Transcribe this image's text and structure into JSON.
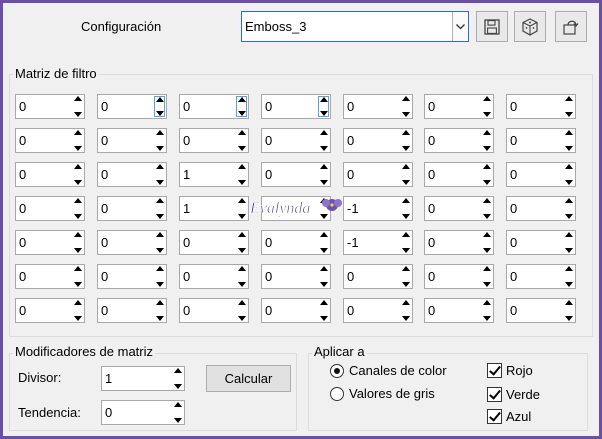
{
  "header": {
    "preset_label": "Configuración",
    "preset_value": "Emboss_3",
    "tools": [
      {
        "icon": "save-icon"
      },
      {
        "icon": "dice-icon"
      },
      {
        "icon": "reset-icon"
      }
    ]
  },
  "matrix": {
    "title": "Matriz de filtro",
    "rows": [
      [
        "0",
        "0",
        "0",
        "0",
        "0",
        "0",
        "0"
      ],
      [
        "0",
        "0",
        "0",
        "0",
        "0",
        "0",
        "0"
      ],
      [
        "0",
        "0",
        "1",
        "0",
        "0",
        "0",
        "0"
      ],
      [
        "0",
        "0",
        "1",
        "",
        "-1",
        "0",
        "0"
      ],
      [
        "0",
        "0",
        "0",
        "0",
        "-1",
        "0",
        "0"
      ],
      [
        "0",
        "0",
        "0",
        "0",
        "0",
        "0",
        "0"
      ],
      [
        "0",
        "0",
        "0",
        "0",
        "0",
        "0",
        "0"
      ]
    ]
  },
  "modifiers": {
    "title": "Modificadores de matriz",
    "divisor_label": "Divisor:",
    "divisor_value": "1",
    "bias_label": "Tendencia:",
    "bias_value": "0",
    "calc_label": "Calcular"
  },
  "apply": {
    "title": "Aplicar a",
    "color_label": "Canales de color",
    "gray_label": "Valores de gris",
    "red_label": "Rojo",
    "green_label": "Verde",
    "blue_label": "Azul"
  },
  "watermark": {
    "text": "Evalynda"
  },
  "colors": {
    "frame": "#6a4fa8",
    "focus_border": "#2a6cc7"
  }
}
